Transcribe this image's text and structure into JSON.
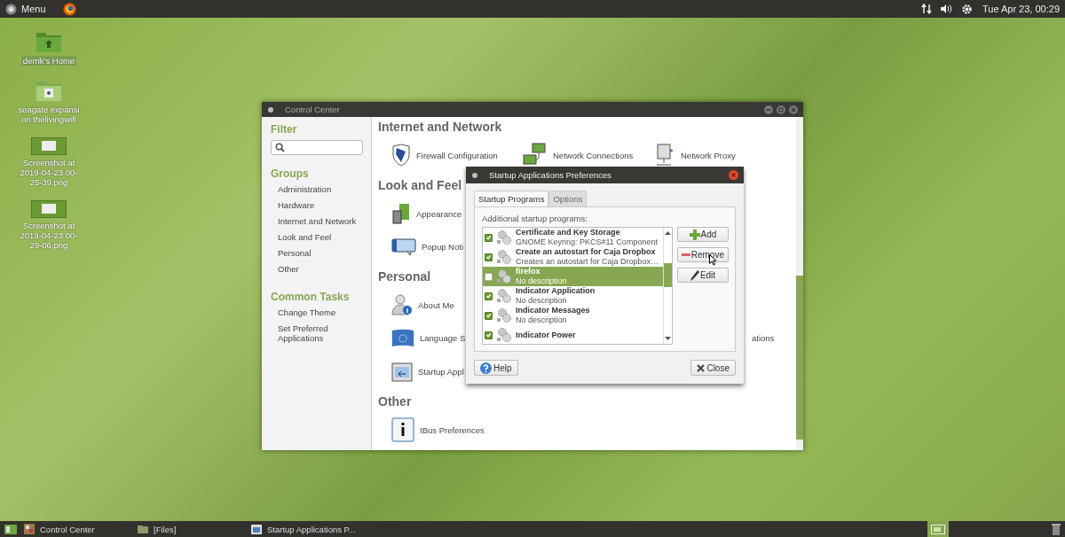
{
  "top_panel": {
    "menu_label": "Menu",
    "clock": "Tue Apr 23, 00:29"
  },
  "desktop_icons": [
    {
      "label": "derrik's Home",
      "kind": "home-folder",
      "selected": true
    },
    {
      "label": "seagate expansi on thelivingwifi",
      "kind": "drive-folder",
      "selected": false
    },
    {
      "label": "Screenshot at 2019-04-23 00-25-39.png",
      "kind": "image",
      "selected": false
    },
    {
      "label": "Screenshot at 2019-04-23 00-29-06.png",
      "kind": "image",
      "selected": false
    }
  ],
  "control_center": {
    "title": "Control Center",
    "sidebar": {
      "filter_heading": "Filter",
      "groups_heading": "Groups",
      "groups": [
        "Administration",
        "Hardware",
        "Internet and Network",
        "Look and Feel",
        "Personal",
        "Other"
      ],
      "tasks_heading": "Common Tasks",
      "tasks": [
        "Change Theme",
        "Set Preferred Applications"
      ]
    },
    "sections": [
      {
        "heading": "Internet and Network",
        "rows": [
          [
            {
              "label": "Firewall Configuration",
              "kind": "shield"
            },
            {
              "label": "Network Connections",
              "kind": "network"
            },
            {
              "label": "Network Proxy",
              "kind": "proxy"
            }
          ]
        ]
      },
      {
        "heading": "Look and Feel",
        "rows": [
          [
            {
              "label": "Appearance",
              "kind": "appearance"
            }
          ],
          [
            {
              "label": "Popup Noti",
              "kind": "popup"
            }
          ]
        ]
      },
      {
        "heading": "Personal",
        "rows": [
          [
            {
              "label": "About Me",
              "kind": "person"
            }
          ],
          [
            {
              "label": "Language S",
              "kind": "flag"
            },
            null,
            {
              "label": "ations",
              "kind": "tail"
            }
          ],
          [
            {
              "label": "Startup Appl",
              "kind": "startup"
            }
          ]
        ]
      },
      {
        "heading": "Other",
        "rows": [
          [
            {
              "label": "IBus Preferences",
              "kind": "info"
            }
          ]
        ]
      }
    ]
  },
  "dialog": {
    "title": "Startup Applications Preferences",
    "tabs": [
      {
        "label": "Startup Programs",
        "selected": true
      },
      {
        "label": "Options",
        "selected": false
      }
    ],
    "list_label": "Additional startup programs:",
    "programs": [
      {
        "name": "Certificate and Key Storage",
        "description": "GNOME Keyring: PKCS#11 Component",
        "checked": true,
        "selected": false
      },
      {
        "name": "Create an autostart for Caja Dropbox",
        "description": "Creates an autostart for Caja Dropbox…",
        "checked": true,
        "selected": false
      },
      {
        "name": "firefox",
        "description": "No description",
        "checked": false,
        "selected": true
      },
      {
        "name": "Indicator Application",
        "description": "No description",
        "checked": true,
        "selected": false
      },
      {
        "name": "Indicator Messages",
        "description": "No description",
        "checked": true,
        "selected": false
      },
      {
        "name": "Indicator Power",
        "checked": true,
        "selected": false
      }
    ],
    "side_buttons": [
      {
        "label": "Add",
        "kind": "add"
      },
      {
        "label": "Remove",
        "kind": "remove"
      },
      {
        "label": "Edit",
        "kind": "edit"
      }
    ],
    "help_button": "Help",
    "close_button": "Close"
  },
  "taskbar": {
    "items": [
      {
        "label": "Control Center",
        "kind": "control"
      },
      {
        "label": "[Files]",
        "kind": "folder"
      },
      {
        "label": "Startup Applications P...",
        "kind": "startup"
      }
    ]
  }
}
